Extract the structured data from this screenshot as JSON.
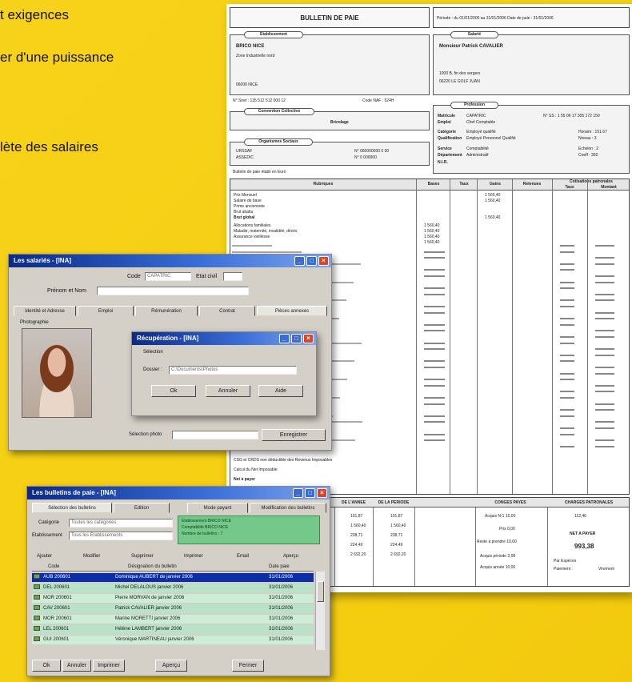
{
  "marketing": {
    "line1": "t exigences",
    "line2": "er d'une puissance",
    "line3": "lète des salaires"
  },
  "payslip": {
    "title": "BULLETIN DE PAIE",
    "period": "Période :  du 01/01/2006  au  31/01/2006      Date de paie :  31/01/2006",
    "etablissement_label": "Etablissement",
    "etablissement_name": "BRICO NICE",
    "etablissement_addr1": "Zone Industrielle nord",
    "etablissement_addr2": "06000 NICE",
    "siret": "N° Siret : 135 512 512 000 12",
    "ape": "Code NAF : 524H",
    "convention_label": "Convention Collective",
    "convention_value": "Bricolage",
    "organismes_label": "Organismes Sociaux",
    "org1": "URSSAF",
    "org2": "ASSEDIC",
    "org1_num": "N° 060000000 0 00",
    "org2_num": "N° 0 000000",
    "bulletin_euro": "Bulletin de paie établi en Euro",
    "salarie_label": "Salarié",
    "salarie_name": "Monsieur Patrick CAVALIER",
    "salarie_addr1": "1000 B, fin des vergers",
    "salarie_addr2": "06220 LE GOLF JUAN",
    "profession_label": "Profession",
    "prof_rows": [
      {
        "k": "Matricule",
        "v": "CAPATRIC"
      },
      {
        "k": "Emploi",
        "v": "Chef Comptable"
      },
      {
        "k": "Catégorie",
        "v": "Employé qualifié"
      },
      {
        "k": "Qualification",
        "v": "Employé Personnel Qualifié"
      },
      {
        "k": "Service",
        "v": "Comptabilité"
      },
      {
        "k": "Département",
        "v": "Administratif"
      },
      {
        "k": "N.I.R.",
        "v": ""
      }
    ],
    "prof_right": [
      "N° SS : 1 55 06 17 305 172 150",
      "Horaire : 151.67",
      "Niveau : 3",
      "Echelon : 2",
      "Coeff : 350"
    ],
    "columns": [
      "Rubriques",
      "Bases",
      "Taux",
      "Gains",
      "Retenues",
      "Taux",
      "Montant"
    ],
    "employer_header": "Cotisations patronales",
    "rubriques": [
      "Prix Mensuel",
      "Salaire de base",
      "Prime anciennete",
      "Brut abattu",
      "Brut global",
      "Allocations familiales",
      "Maladie, maternité, invalidité, décès",
      "Assurance vieillesse"
    ],
    "totals": [
      "CSG et CRDS non déductible des Revenus Imposables",
      "Calcul du Net Imposable",
      "Net à payer"
    ],
    "gains_values": [
      "1 560,40",
      "1 560,40",
      "1 560,40"
    ],
    "bases_values": [
      "1 560,40",
      "1 560,40",
      "1 560,40",
      "1 560,40"
    ],
    "bottom_headers": [
      "DE L'ANNEE",
      "DE LA PERIODE",
      "CONGES PAYES",
      "CHARGES PATRONALES"
    ],
    "bottom_values_year": [
      "101,87",
      "1 560,40",
      "238,71",
      "224,49",
      "2 692,20"
    ],
    "bottom_values_period": [
      "101,87",
      "1 560,40",
      "238,71",
      "224,49",
      "2 692,20"
    ],
    "conges_rows": [
      "Acquis N-1   10,00",
      "Pris   0,00",
      "Reste à prendre   10,00",
      "Acquis période   2,08",
      "Acquis année   10,00"
    ],
    "charges_value": "112,46",
    "net_label": "NET A PAYER",
    "net_value": "993,38",
    "reglement_label": "Par Espèces",
    "paiement_label": "Paiement :",
    "paiement_value": "Virement"
  },
  "salarie_window": {
    "title": "Les salariés - [INA]",
    "code_label": "Code",
    "code_value": "CAPATRIC",
    "etat_label": "Etat civil",
    "prenom_label": "Prénom et Nom",
    "tabs": [
      "Identité et Adresse",
      "Emploi",
      "Rémunération",
      "Contrat",
      "Pièces annexes"
    ],
    "photo_label": "Photographie",
    "photo_field_label": "Sélection photo",
    "validate_button": "Enregistrer"
  },
  "dialog": {
    "title": "Récupération - [INA]",
    "section": "Sélection",
    "field_label": "Dossier :",
    "field_value": "C:\\Documents\\Photos",
    "ok": "Ok",
    "cancel": "Annuler",
    "help": "Aide"
  },
  "bulletins_window": {
    "title": "Les bulletins de paie - [INA]",
    "tabs": [
      "Sélection des bulletins",
      "Edition"
    ],
    "tab_right": [
      "Mode payant",
      "Modification des bulletins"
    ],
    "categorie_label": "Catégorie",
    "categorie_value": "Toutes les catégories",
    "etablissement_label": "Etablissement",
    "etablissement_value": "Tous les Etablissements",
    "info_lines": [
      "Etablissement BRICO NICE",
      "Comptabilité BRICO NICE",
      "Nombre de bulletins : 7"
    ],
    "toolbar": [
      "Ajouter",
      "Modifier",
      "Supprimer",
      "Imprimer",
      "Email",
      "Aperçu"
    ],
    "list_headers": [
      "Code",
      "Désignation du bulletin",
      "Date paie"
    ],
    "rows": [
      {
        "code": "AUB 200601",
        "name": "Dominique AUBERT de janvier 2006",
        "date": "31/01/2006"
      },
      {
        "code": "DEL 200601",
        "name": "Michel DELALOUS janvier 2006",
        "date": "31/01/2006"
      },
      {
        "code": "MOR 200601",
        "name": "Pierre MORVAN de janvier 2006",
        "date": "31/01/2006"
      },
      {
        "code": "CAV 200601",
        "name": "Patrick CAVALIER janvier 2006",
        "date": "31/01/2006"
      },
      {
        "code": "MOR 200601",
        "name": "Marine MORETTI janvier 2006",
        "date": "31/01/2006"
      },
      {
        "code": "LEL 200601",
        "name": "Hélène LAMBERT janvier 2006",
        "date": "31/01/2006"
      },
      {
        "code": "GUI 200601",
        "name": "Véronique MARTINEAU janvier 2006",
        "date": "31/01/2006"
      }
    ],
    "bottom_buttons": [
      "Ok",
      "Annuler",
      "Imprimer",
      "Aperçu",
      "Fermer"
    ]
  }
}
